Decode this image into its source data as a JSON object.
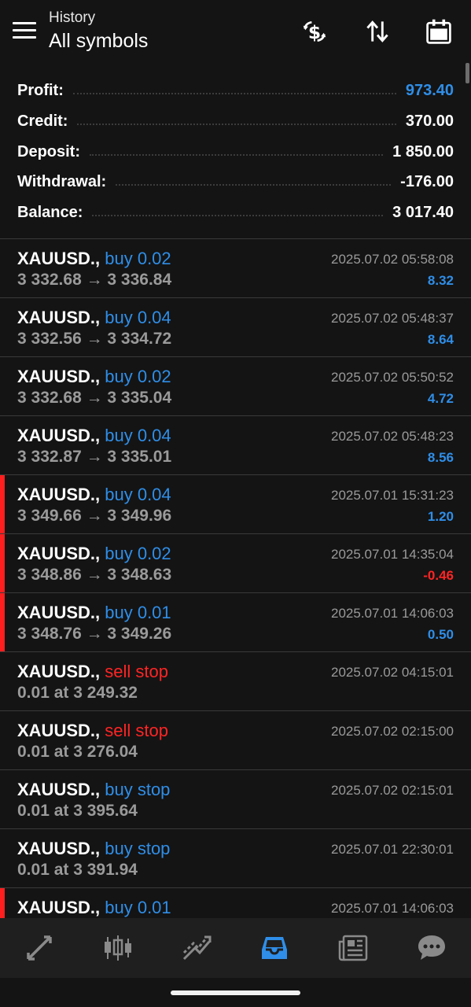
{
  "header": {
    "subtitle": "History",
    "title": "All symbols"
  },
  "summary": {
    "profit": {
      "label": "Profit:",
      "value": "973.40"
    },
    "credit": {
      "label": "Credit:",
      "value": "370.00"
    },
    "deposit": {
      "label": "Deposit:",
      "value": "1 850.00"
    },
    "withdrawal": {
      "label": "Withdrawal:",
      "value": "-176.00"
    },
    "balance": {
      "label": "Balance:",
      "value": "3 017.40"
    }
  },
  "rows": [
    {
      "symbol": "XAUUSD.,",
      "type": "buy 0.02",
      "kind": "buy",
      "price": "3 332.68 → 3 336.84",
      "time": "2025.07.02 05:58:08",
      "pl": "8.32",
      "pl_sign": "pos",
      "flag": false
    },
    {
      "symbol": "XAUUSD.,",
      "type": "buy 0.04",
      "kind": "buy",
      "price": "3 332.56 → 3 334.72",
      "time": "2025.07.02 05:48:37",
      "pl": "8.64",
      "pl_sign": "pos",
      "flag": false
    },
    {
      "symbol": "XAUUSD.,",
      "type": "buy 0.02",
      "kind": "buy",
      "price": "3 332.68 → 3 335.04",
      "time": "2025.07.02 05:50:52",
      "pl": "4.72",
      "pl_sign": "pos",
      "flag": false
    },
    {
      "symbol": "XAUUSD.,",
      "type": "buy 0.04",
      "kind": "buy",
      "price": "3 332.87 → 3 335.01",
      "time": "2025.07.02 05:48:23",
      "pl": "8.56",
      "pl_sign": "pos",
      "flag": false
    },
    {
      "symbol": "XAUUSD.,",
      "type": "buy 0.04",
      "kind": "buy",
      "price": "3 349.66 → 3 349.96",
      "time": "2025.07.01 15:31:23",
      "pl": "1.20",
      "pl_sign": "pos",
      "flag": true
    },
    {
      "symbol": "XAUUSD.,",
      "type": "buy 0.02",
      "kind": "buy",
      "price": "3 348.86 → 3 348.63",
      "time": "2025.07.01 14:35:04",
      "pl": "-0.46",
      "pl_sign": "neg",
      "flag": true
    },
    {
      "symbol": "XAUUSD.,",
      "type": "buy 0.01",
      "kind": "buy",
      "price": "3 348.76 → 3 349.26",
      "time": "2025.07.01 14:06:03",
      "pl": "0.50",
      "pl_sign": "pos",
      "flag": true
    },
    {
      "symbol": "XAUUSD.,",
      "type": "sell stop",
      "kind": "sell",
      "price": "0.01 at 3 249.32",
      "time": "2025.07.02 04:15:01",
      "pl": "",
      "pl_sign": "pos",
      "flag": false
    },
    {
      "symbol": "XAUUSD.,",
      "type": "sell stop",
      "kind": "sell",
      "price": "0.01 at 3 276.04",
      "time": "2025.07.02 02:15:00",
      "pl": "",
      "pl_sign": "pos",
      "flag": false
    },
    {
      "symbol": "XAUUSD.,",
      "type": "buy stop",
      "kind": "buy",
      "price": "0.01 at 3 395.64",
      "time": "2025.07.02 02:15:01",
      "pl": "",
      "pl_sign": "pos",
      "flag": false
    },
    {
      "symbol": "XAUUSD.,",
      "type": "buy stop",
      "kind": "buy",
      "price": "0.01 at 3 391.94",
      "time": "2025.07.01 22:30:01",
      "pl": "",
      "pl_sign": "pos",
      "flag": false
    },
    {
      "symbol": "XAUUSD.,",
      "type": "buy 0.01",
      "kind": "buy",
      "price": "",
      "time": "2025.07.01 14:06:03",
      "pl": "",
      "pl_sign": "pos",
      "flag": true
    }
  ],
  "colors": {
    "background": "#141414",
    "blue": "#2f8ee8",
    "red": "#ff2424",
    "gray_text": "#9a9a9a",
    "nav_bar": "#1f1f1f"
  },
  "icons": {
    "header": [
      "menu-icon",
      "currency-exchange-icon",
      "sort-icon",
      "calendar-icon"
    ],
    "nav": [
      "quotes-icon",
      "chart-icon",
      "trade-icon",
      "history-icon",
      "news-icon",
      "messages-icon"
    ],
    "active_nav": "history-icon"
  }
}
